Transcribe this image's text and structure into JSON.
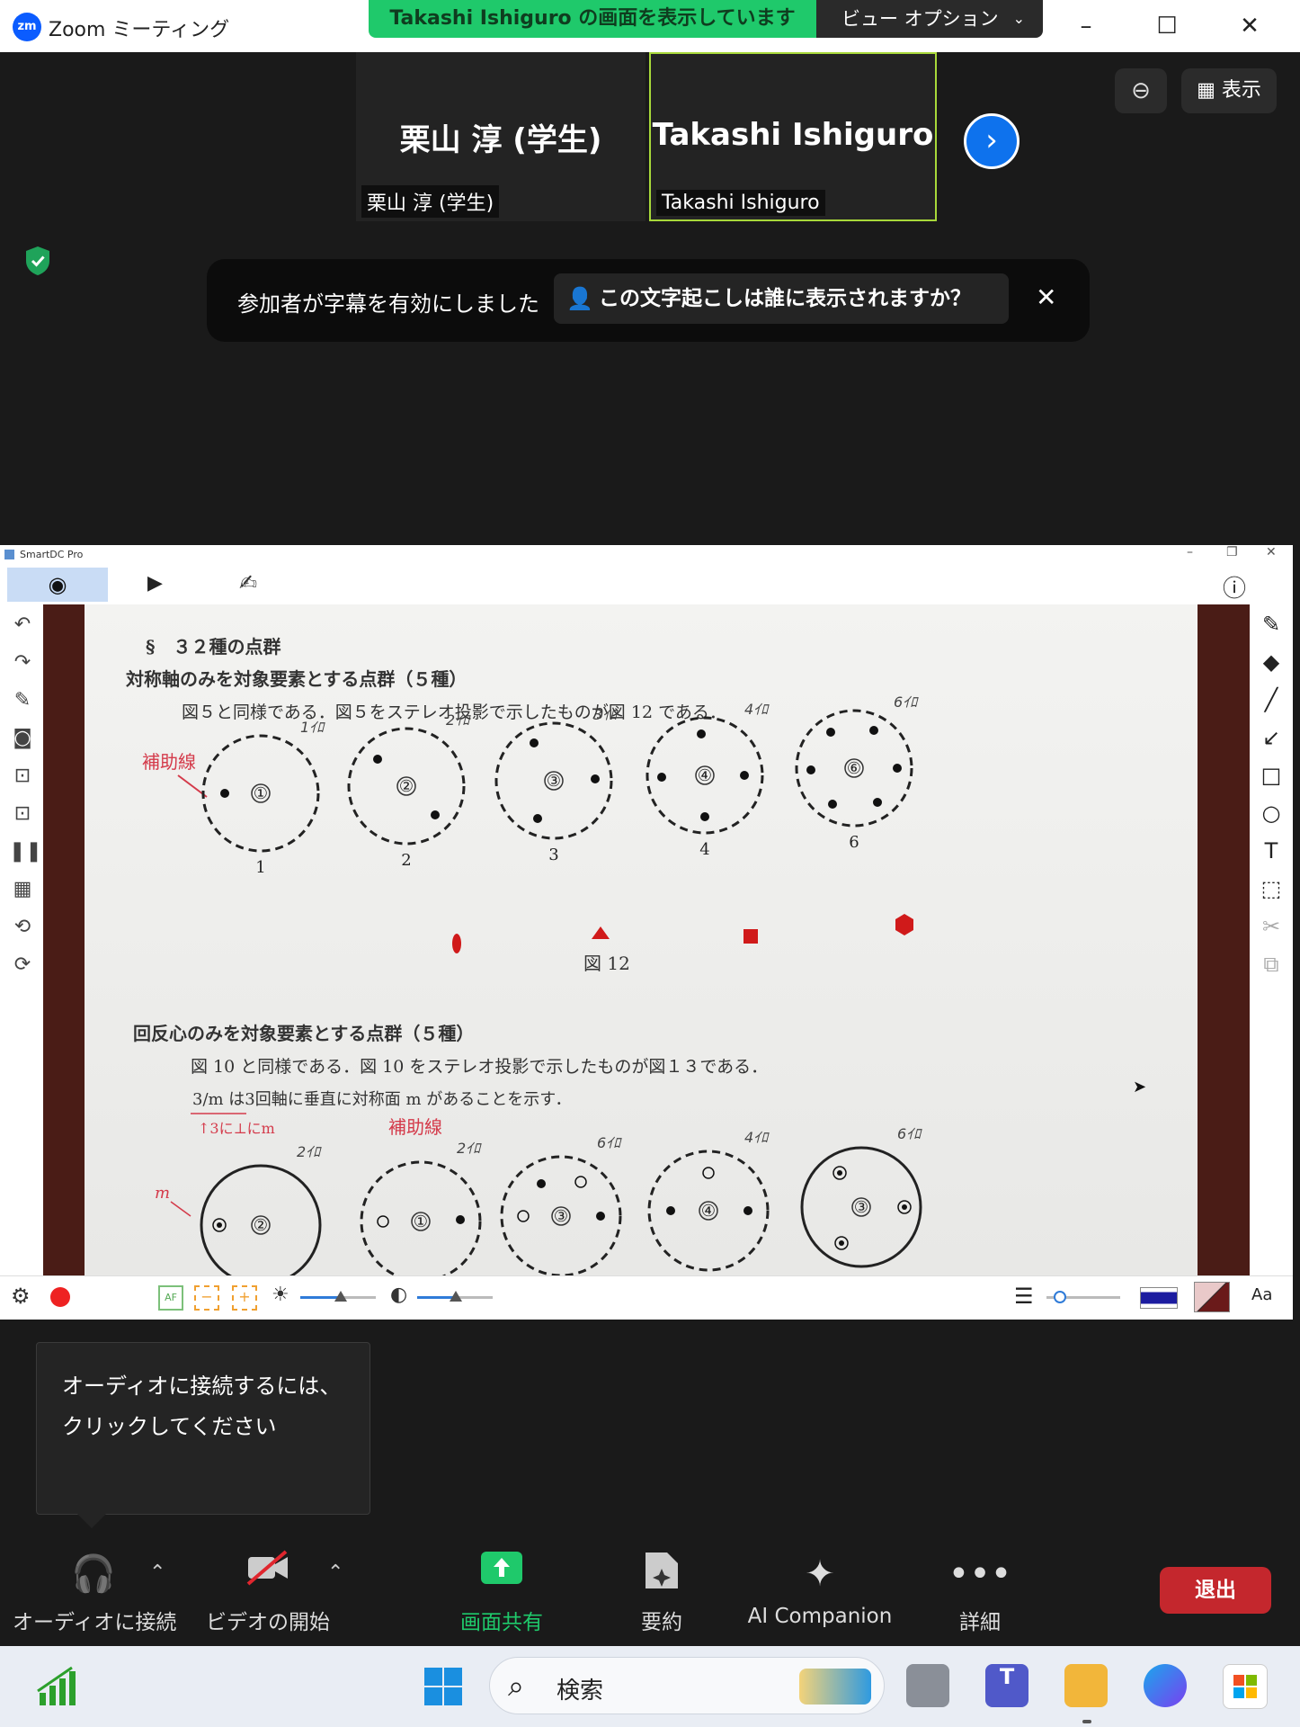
{
  "titlebar": {
    "app_title": "Zoom ミーティング",
    "logo_text": "zm",
    "share_banner": "Takashi Ishiguro の画面を表示しています",
    "view_options": "ビュー オプション"
  },
  "participants": [
    {
      "display_name": "栗山 淳 (学生)",
      "label": "栗山 淳 (学生)",
      "active_speaker": false
    },
    {
      "display_name": "Takashi Ishiguro",
      "label": "Takashi Ishiguro",
      "active_speaker": true
    }
  ],
  "top_right": {
    "view_label": "表示"
  },
  "caption_notice": {
    "text": "参加者が字幕を有効にしました",
    "question": "この文字起こしは誰に表示されますか？"
  },
  "shared_window": {
    "title": "SmartDC Pro",
    "document": {
      "section1_heading": "§　３２種の点群",
      "section1_subheading": "対称軸のみを対象要素とする点群（５種）",
      "section1_body": "図５と同様である．図５をステレオ投影で示したものが図 12 である．",
      "annotation_aux": "補助線",
      "figure_label": "図 12",
      "circles_top": [
        {
          "center": "①",
          "number": "1",
          "note": "1ｲﾛ"
        },
        {
          "center": "②",
          "number": "2",
          "note": "2ｲﾛ"
        },
        {
          "center": "③",
          "number": "3",
          "note": "3ｲﾛ"
        },
        {
          "center": "④",
          "number": "4",
          "note": "4ｲﾛ"
        },
        {
          "center": "⑥",
          "number": "6",
          "note": "6ｲﾛ"
        }
      ],
      "section2_heading": "回反心のみを対象要素とする点群（５種）",
      "section2_body": "図 10 と同様である．図 10 をステレオ投影で示したものが図１３である．",
      "section2_note": "3/m は3回軸に垂直に対称面 m があることを示す．",
      "annotation_perp": "↑3に⊥にm",
      "annotation_aux2": "補助線",
      "annotation_m": "m",
      "circles_bottom": [
        {
          "center": "②",
          "note": "2ｲﾛ"
        },
        {
          "center": "①",
          "note": "2ｲﾛ"
        },
        {
          "center": "③",
          "note": "6ｲﾛ"
        },
        {
          "center": "④",
          "note": "4ｲﾛ"
        },
        {
          "center": "③",
          "note": "6ｲﾛ"
        }
      ]
    },
    "bottom_bar": {
      "font_label": "Aa"
    }
  },
  "audio_tooltip": "オーディオに接続するには、クリックしてください",
  "controls": {
    "audio": "オーディオに接続",
    "video": "ビデオの開始",
    "share": "画面共有",
    "summary": "要約",
    "ai": "AI Companion",
    "more": "詳細",
    "leave": "退出"
  },
  "taskbar": {
    "search": "検索"
  },
  "colors": {
    "zoom_blue": "#0b5cff",
    "share_green": "#1fc96b",
    "leave_red": "#c4272d",
    "active_speaker_border": "#a8d83a"
  }
}
